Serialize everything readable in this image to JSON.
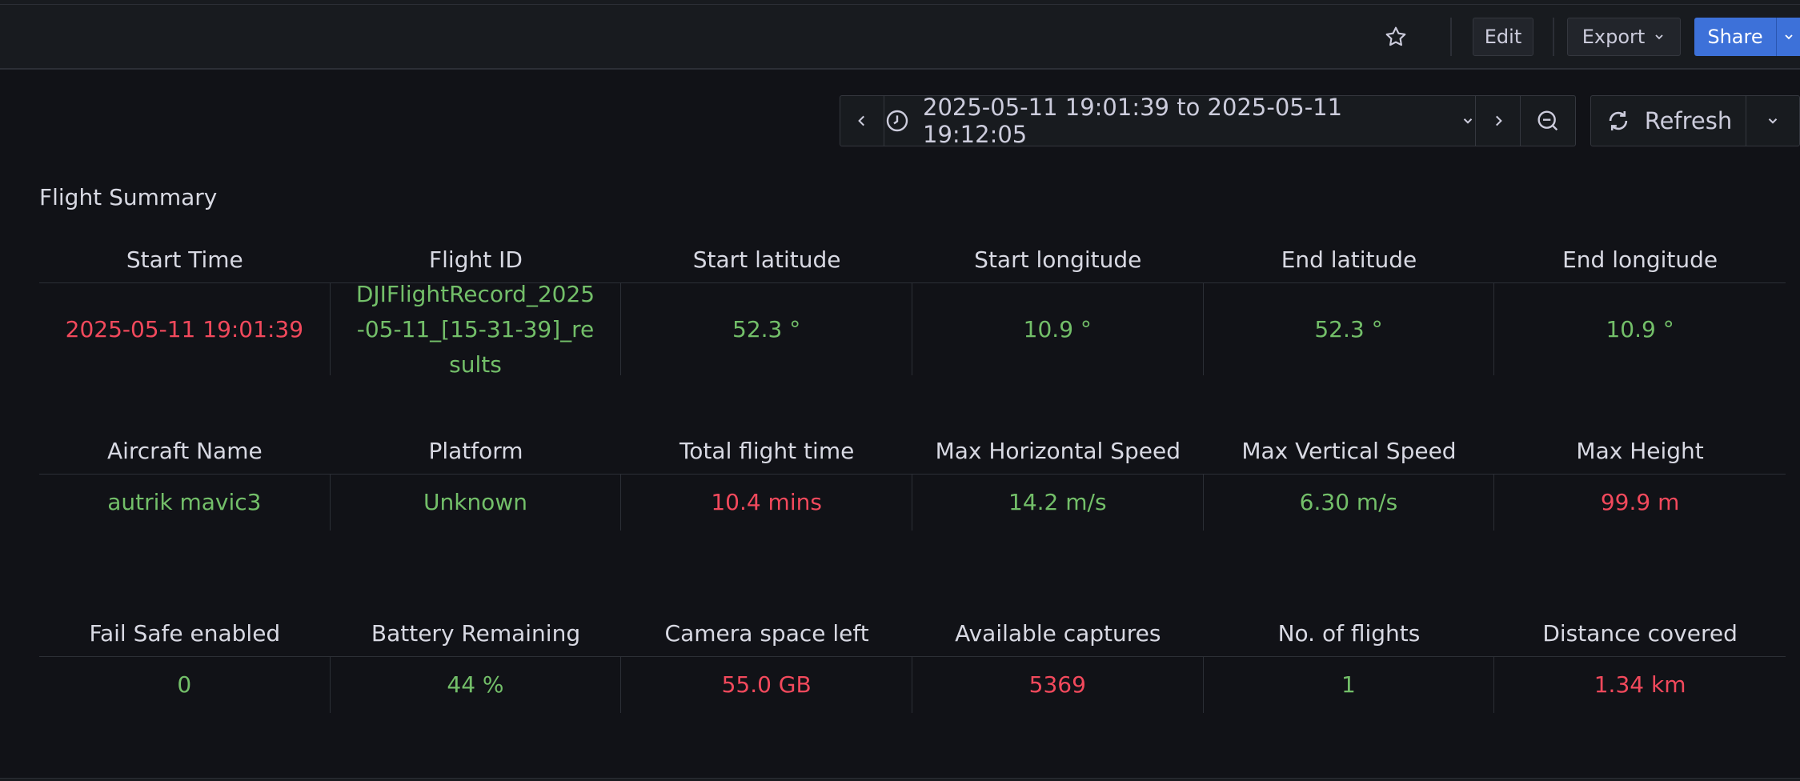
{
  "toolbar": {
    "edit_label": "Edit",
    "export_label": "Export",
    "share_label": "Share"
  },
  "time_range": {
    "label": "2025-05-11 19:01:39 to 2025-05-11 19:12:05",
    "refresh_label": "Refresh"
  },
  "panel": {
    "title": "Flight Summary",
    "rows": [
      {
        "headers": [
          "Start Time",
          "Flight ID",
          "Start latitude",
          "Start longitude",
          "End latitude",
          "End longitude"
        ],
        "values": [
          "2025-05-11 19:01:39",
          "DJIFlightRecord_2025-05-11_[15-31-39]_results",
          "52.3 °",
          "10.9 °",
          "52.3 °",
          "10.9 °"
        ],
        "colors": [
          "red",
          "green",
          "green",
          "green",
          "green",
          "green"
        ]
      },
      {
        "headers": [
          "Aircraft Name",
          "Platform",
          "Total flight time",
          "Max Horizontal Speed",
          "Max Vertical Speed",
          "Max Height"
        ],
        "values": [
          "autrik mavic3",
          "Unknown",
          "10.4 mins",
          "14.2 m/s",
          "6.30 m/s",
          "99.9 m"
        ],
        "colors": [
          "green",
          "green",
          "red",
          "green",
          "green",
          "red"
        ]
      },
      {
        "headers": [
          "Fail Safe enabled",
          "Battery Remaining",
          "Camera space left",
          "Available captures",
          "No. of flights",
          "Distance covered"
        ],
        "values": [
          "0",
          "44 %",
          "55.0 GB",
          "5369",
          "1",
          "1.34 km"
        ],
        "colors": [
          "green",
          "green",
          "red",
          "red",
          "green",
          "red"
        ]
      }
    ]
  },
  "colors": {
    "green": "#73bf69",
    "red": "#f2495c",
    "accent": "#3d71d9",
    "background": "#111217"
  },
  "icons": [
    "star-icon",
    "chevron-down-icon",
    "chevron-left-icon",
    "clock-icon",
    "chevron-right-icon",
    "zoom-out-icon",
    "refresh-icon"
  ]
}
